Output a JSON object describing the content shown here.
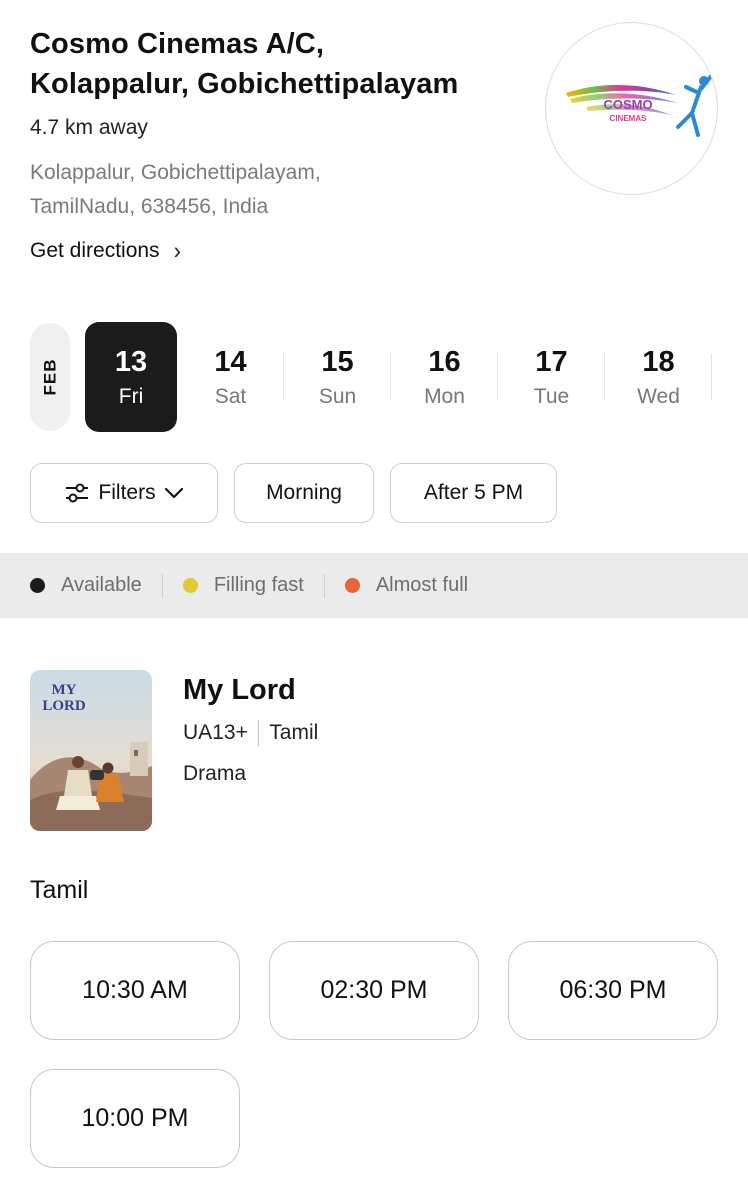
{
  "cinema": {
    "name_line1": "Cosmo Cinemas A/C,",
    "name_line2": "Kolappalur, Gobichettipalayam",
    "distance": "4.7 km away",
    "address_line1": "Kolappalur, Gobichettipalayam,",
    "address_line2": "TamilNadu, 638456, India",
    "directions_label": "Get directions",
    "logo_text_line1": "COSMO",
    "logo_text_line2": "CINEMAS"
  },
  "date_picker": {
    "month": "FEB",
    "dates": [
      {
        "num": "13",
        "day": "Fri",
        "selected": true
      },
      {
        "num": "14",
        "day": "Sat",
        "selected": false
      },
      {
        "num": "15",
        "day": "Sun",
        "selected": false
      },
      {
        "num": "16",
        "day": "Mon",
        "selected": false
      },
      {
        "num": "17",
        "day": "Tue",
        "selected": false
      },
      {
        "num": "18",
        "day": "Wed",
        "selected": false
      }
    ]
  },
  "filters": {
    "filters_label": "Filters",
    "morning_label": "Morning",
    "after5_label": "After 5 PM"
  },
  "legend": [
    {
      "label": "Available",
      "color": "#1b1b1b"
    },
    {
      "label": "Filling fast",
      "color": "#e2c936"
    },
    {
      "label": "Almost full",
      "color": "#e8643a"
    }
  ],
  "movie": {
    "title": "My Lord",
    "rating": "UA13+",
    "language": "Tamil",
    "genre": "Drama",
    "poster_text_line1": "MY",
    "poster_text_line2": "LORD"
  },
  "showtimes_section": {
    "language_heading": "Tamil",
    "times": [
      "10:30 AM",
      "02:30 PM",
      "06:30 PM",
      "10:00 PM"
    ]
  }
}
